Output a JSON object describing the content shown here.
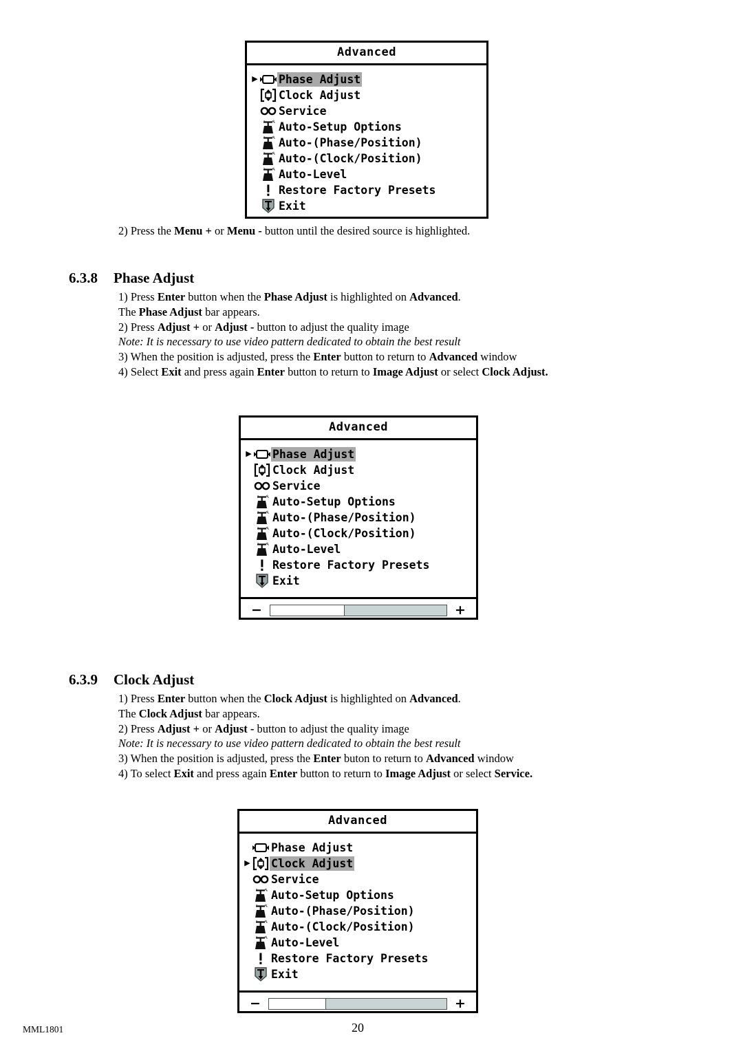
{
  "document": {
    "footer_code": "MML1801",
    "page_number": "20"
  },
  "colors": {
    "highlight": "#a9a9a9",
    "slider_track": "#c9d5d5",
    "slider_fill": "#ffffff",
    "border": "#000000"
  },
  "osd_menu": {
    "title": "Advanced",
    "items": [
      {
        "icon": "horizontal-double-arrow-icon",
        "label": "Phase Adjust"
      },
      {
        "icon": "vertical-double-arrow-bracket-icon",
        "label": "Clock Adjust"
      },
      {
        "icon": "service-two-circles-icon",
        "label": "Service"
      },
      {
        "icon": "auto-podium-icon",
        "label": "Auto-Setup Options"
      },
      {
        "icon": "auto-podium-icon",
        "label": "Auto-(Phase/Position)"
      },
      {
        "icon": "auto-podium-icon",
        "label": "Auto-(Clock/Position)"
      },
      {
        "icon": "auto-podium-icon",
        "label": "Auto-Level"
      },
      {
        "icon": "exclamation-icon",
        "label": "Restore Factory Presets"
      },
      {
        "icon": "exit-shield-arrow-icon",
        "label": "Exit"
      }
    ],
    "bar": {
      "minus_label": "−",
      "plus_label": "+"
    }
  },
  "screens": {
    "first": {
      "selected_index": 0,
      "has_bar": false
    },
    "second": {
      "selected_index": 0,
      "has_bar": true,
      "bar_value_percent": 42
    },
    "third": {
      "selected_index": 1,
      "has_bar": true,
      "bar_value_percent": 32
    }
  },
  "intro_step": {
    "prefix": "2) Press the ",
    "b1": "Menu +",
    "mid1": " or ",
    "b2": "Menu -",
    "suffix": " button until the desired source is highlighted."
  },
  "section_638": {
    "number": "6.3.8",
    "title": "Phase Adjust",
    "lines": [
      {
        "parts": [
          {
            "t": "1) Press ",
            "b": false
          },
          {
            "t": "Enter",
            "b": true
          },
          {
            "t": " button when the ",
            "b": false
          },
          {
            "t": "Phase Adjust",
            "b": true
          },
          {
            "t": " is highlighted on ",
            "b": false
          },
          {
            "t": "Advanced",
            "b": true
          },
          {
            "t": ".",
            "b": false
          }
        ]
      },
      {
        "parts": [
          {
            "t": "The ",
            "b": false
          },
          {
            "t": "Phase Adjust",
            "b": true
          },
          {
            "t": " bar appears.",
            "b": false
          }
        ]
      },
      {
        "parts": [
          {
            "t": "2) Press ",
            "b": false
          },
          {
            "t": "Adjust +",
            "b": true
          },
          {
            "t": " or ",
            "b": false
          },
          {
            "t": "Adjust -",
            "b": true
          },
          {
            "t": " button to adjust the quality image",
            "b": false
          }
        ]
      },
      {
        "italic": true,
        "parts": [
          {
            "t": "Note: It is necessary to use video pattern dedicated to obtain the best result",
            "b": false
          }
        ]
      },
      {
        "parts": [
          {
            "t": "3) When the position is adjusted, press the ",
            "b": false
          },
          {
            "t": "Enter",
            "b": true
          },
          {
            "t": " button to return to ",
            "b": false
          },
          {
            "t": "Advanced",
            "b": true
          },
          {
            "t": " window",
            "b": false
          }
        ]
      },
      {
        "parts": [
          {
            "t": "4) Select ",
            "b": false
          },
          {
            "t": "Exit",
            "b": true
          },
          {
            "t": " and press again ",
            "b": false
          },
          {
            "t": "Enter",
            "b": true
          },
          {
            "t": " button to return to ",
            "b": false
          },
          {
            "t": "Image Adjust",
            "b": true
          },
          {
            "t": " or select  ",
            "b": false
          },
          {
            "t": "Clock Adjust.",
            "b": true
          }
        ]
      }
    ]
  },
  "section_639": {
    "number": "6.3.9",
    "title": "Clock Adjust",
    "lines": [
      {
        "parts": [
          {
            "t": "1) Press ",
            "b": false
          },
          {
            "t": "Enter",
            "b": true
          },
          {
            "t": " button when the ",
            "b": false
          },
          {
            "t": "Clock Adjust",
            "b": true
          },
          {
            "t": " is highlighted on ",
            "b": false
          },
          {
            "t": "Advanced",
            "b": true
          },
          {
            "t": ".",
            "b": false
          }
        ]
      },
      {
        "parts": [
          {
            "t": "The ",
            "b": false
          },
          {
            "t": "Clock Adjust",
            "b": true
          },
          {
            "t": " bar appears.",
            "b": false
          }
        ]
      },
      {
        "parts": [
          {
            "t": "2) Press ",
            "b": false
          },
          {
            "t": "Adjust +",
            "b": true
          },
          {
            "t": " or ",
            "b": false
          },
          {
            "t": "Adjust -",
            "b": true
          },
          {
            "t": " button to adjust the quality image",
            "b": false
          }
        ]
      },
      {
        "italic": true,
        "parts": [
          {
            "t": "Note: It is necessary to use video pattern dedicated to obtain the best result",
            "b": false
          }
        ]
      },
      {
        "parts": [
          {
            "t": "3) When the position is adjusted, press the ",
            "b": false
          },
          {
            "t": "Enter",
            "b": true
          },
          {
            "t": " buton to return to ",
            "b": false
          },
          {
            "t": "Advanced",
            "b": true
          },
          {
            "t": " window",
            "b": false
          }
        ]
      },
      {
        "parts": [
          {
            "t": "4) To select ",
            "b": false
          },
          {
            "t": "Exit",
            "b": true
          },
          {
            "t": " and press again ",
            "b": false
          },
          {
            "t": "Enter",
            "b": true
          },
          {
            "t": " button to return to ",
            "b": false
          },
          {
            "t": "Image Adjust",
            "b": true
          },
          {
            "t": " or select  ",
            "b": false
          },
          {
            "t": "Service.",
            "b": true
          }
        ]
      }
    ]
  }
}
